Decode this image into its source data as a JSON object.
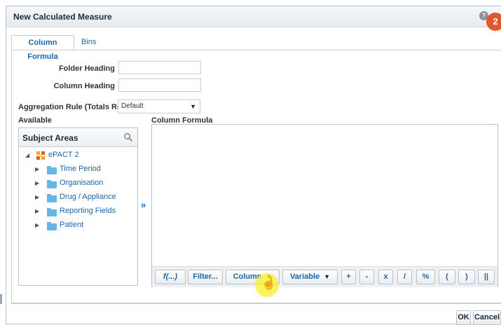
{
  "dialog": {
    "title": "New Calculated Measure",
    "help_icon": "?",
    "badge": "2"
  },
  "tabs": [
    {
      "label": "Column Formula",
      "active": true
    },
    {
      "label": "Bins",
      "active": false
    }
  ],
  "form": {
    "folder_heading_label": "Folder Heading",
    "folder_heading_value": "",
    "column_heading_label": "Column Heading",
    "column_heading_value": "",
    "aggregation_label": "Aggregation Rule (Totals Row)",
    "aggregation_value": "Default",
    "aggregation_icon": "dropdown-arrow-icon"
  },
  "available": {
    "label": "Available",
    "panel_title": "Subject Areas",
    "search_icon": "search-icon",
    "tree": {
      "root": {
        "label": "ePACT 2",
        "icon": "subject-area-icon"
      },
      "items": [
        {
          "label": "Time Period",
          "icon": "folder-icon"
        },
        {
          "label": "Organisation",
          "icon": "folder-icon"
        },
        {
          "label": "Drug / Appliance",
          "icon": "folder-icon"
        },
        {
          "label": "Reporting Fields",
          "icon": "folder-icon"
        },
        {
          "label": "Patient",
          "icon": "folder-icon"
        }
      ]
    },
    "move_icon": "chevron-right-icon"
  },
  "formula": {
    "label": "Column Formula",
    "content": "",
    "toolbar": {
      "function": "f(...)",
      "filter": "Filter...",
      "column": "Column",
      "variable": "Variable",
      "ops": [
        "+",
        "-",
        "x",
        "/",
        "%",
        "(",
        ")",
        "||"
      ]
    }
  },
  "footer": {
    "ok": "OK",
    "cancel": "Cancel"
  },
  "colors": {
    "accent_link": "#1a67ad",
    "badge_bg": "#e2582d",
    "cursor_highlight": "#faf028",
    "folder": "#66b6e6"
  }
}
